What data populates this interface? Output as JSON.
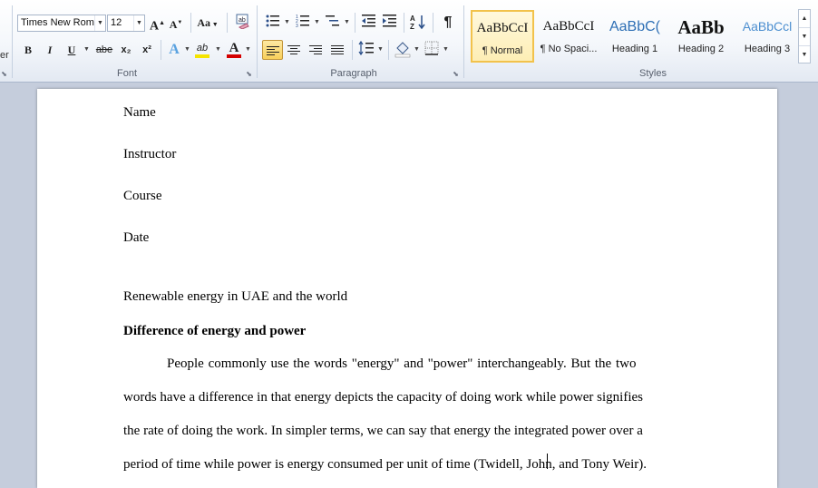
{
  "ribbon": {
    "left_fragment": "er",
    "font": {
      "label": "Font",
      "name": "Times New Rom",
      "size": "12",
      "grow": "A",
      "shrink": "A",
      "change_case": "Aa",
      "bold": "B",
      "italic": "I",
      "underline": "U",
      "strikethrough": "abe",
      "subscript": "x₂",
      "superscript": "x²",
      "text_effects": "A",
      "highlight": "ab",
      "font_color": "A"
    },
    "paragraph": {
      "label": "Paragraph",
      "pilcrow": "¶"
    },
    "styles": {
      "label": "Styles",
      "items": [
        {
          "sample": "AaBbCcI",
          "name": "¶ Normal"
        },
        {
          "sample": "AaBbCcI",
          "name": "¶ No Spaci..."
        },
        {
          "sample": "AaBbC(",
          "name": "Heading 1"
        },
        {
          "sample": "AaBb",
          "name": "Heading 2"
        },
        {
          "sample": "AaBbCcl",
          "name": "Heading 3"
        }
      ]
    }
  },
  "document": {
    "lines": [
      "Name",
      "Instructor",
      "Course",
      "Date",
      "Renewable energy in UAE and the world",
      "Difference of energy and power",
      "People commonly use the words \"energy\" and \"power\" interchangeably. But the two",
      "words have a difference in that energy depicts the capacity of doing work while power signifies",
      "the rate of doing the work. In simpler terms, we can say that energy the integrated power over a",
      "period of time while power is energy consumed per unit of time (Twidell, John, and Tony Weir)."
    ]
  },
  "colors": {
    "highlight": "#f5e400",
    "font_color": "#d40000",
    "selected_style": "#f2c24b",
    "heading_blue": "#2e6fb5"
  }
}
